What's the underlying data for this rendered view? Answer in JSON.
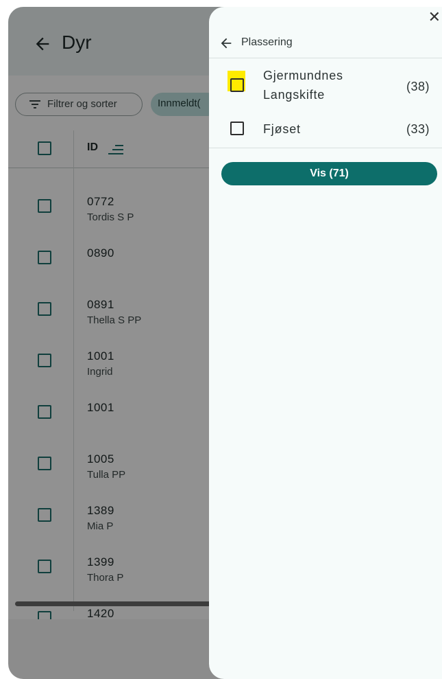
{
  "header": {
    "title": "Dyr"
  },
  "filters": {
    "filter_sort_label": "Filtrer og sorter",
    "active_chip_label": "Innmeldt("
  },
  "table": {
    "id_header": "ID",
    "rows": [
      {
        "id": "0772",
        "name": "Tordis S P"
      },
      {
        "id": "0890",
        "name": ""
      },
      {
        "id": "0891",
        "name": "Thella S PP"
      },
      {
        "id": "1001",
        "name": "Ingrid"
      },
      {
        "id": "1001",
        "name": ""
      },
      {
        "id": "1005",
        "name": "Tulla PP"
      },
      {
        "id": "1389",
        "name": "Mia P"
      },
      {
        "id": "1399",
        "name": "Thora P"
      },
      {
        "id": "1420",
        "name": ""
      }
    ]
  },
  "sheet": {
    "title": "Plassering",
    "close_icon": "close-icon",
    "options": [
      {
        "label_line1": "Gjermundnes",
        "label_line2": "Langskifte",
        "count": "(38)",
        "checked": false
      },
      {
        "label_line1": "Fjøset",
        "label_line2": "",
        "count": "(33)",
        "checked": false
      }
    ],
    "show_button": "Vis (71)"
  },
  "colors": {
    "accent": "#0d6e6a",
    "highlight": "#ffeb00",
    "chip": "#bfe2df"
  }
}
